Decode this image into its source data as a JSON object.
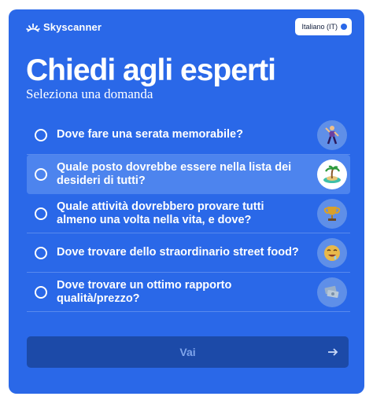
{
  "brand": {
    "name": "Skyscanner"
  },
  "language": {
    "label": "Italiano (IT)"
  },
  "header": {
    "title": "Chiedi agli esperti",
    "subtitle": "Seleziona una domanda"
  },
  "options": [
    {
      "text": "Dove fare una serata memorabile?",
      "icon": "dancer-icon",
      "selected": false
    },
    {
      "text": "Quale posto dovrebbe essere nella lista dei desideri di tutti?",
      "icon": "island-icon",
      "selected": true
    },
    {
      "text": "Quale attività dovrebbero provare tutti almeno una volta nella vita, e dove?",
      "icon": "trophy-icon",
      "selected": false
    },
    {
      "text": "Dove trovare dello straordinario street food?",
      "icon": "drooling-face-icon",
      "selected": false
    },
    {
      "text": "Dove trovare un ottimo rapporto qualità/prezzo?",
      "icon": "money-icon",
      "selected": false
    }
  ],
  "cta": {
    "label": "Vai"
  },
  "colors": {
    "card": "#2a68e8",
    "selected_row": "#4d84ee",
    "button": "#1c4aa8",
    "text": "#ffffff"
  }
}
